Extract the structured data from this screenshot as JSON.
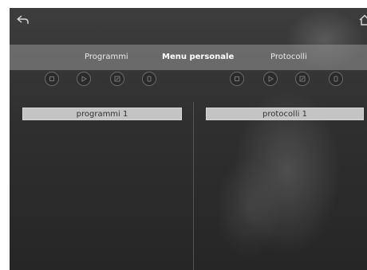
{
  "header": {
    "back_icon": "back-arrow-icon",
    "home_icon": "home-icon"
  },
  "tabs": [
    {
      "label": "Programmi",
      "active": false
    },
    {
      "label": "Menu personale",
      "active": true
    },
    {
      "label": "Protocolli",
      "active": false
    }
  ],
  "left_panel": {
    "toolbar_icons": [
      "stop-icon",
      "play-icon",
      "edit-icon",
      "delete-icon"
    ],
    "items": [
      {
        "label": "programmi 1"
      }
    ]
  },
  "right_panel": {
    "toolbar_icons": [
      "stop-icon",
      "play-icon",
      "edit-icon",
      "delete-icon"
    ],
    "items": [
      {
        "label": "protocolli 1"
      }
    ]
  },
  "colors": {
    "background": "#2f2f2f",
    "tab_bar": "#969696",
    "item_bar": "#c4c4c4",
    "text_light": "#e8e8e8"
  }
}
